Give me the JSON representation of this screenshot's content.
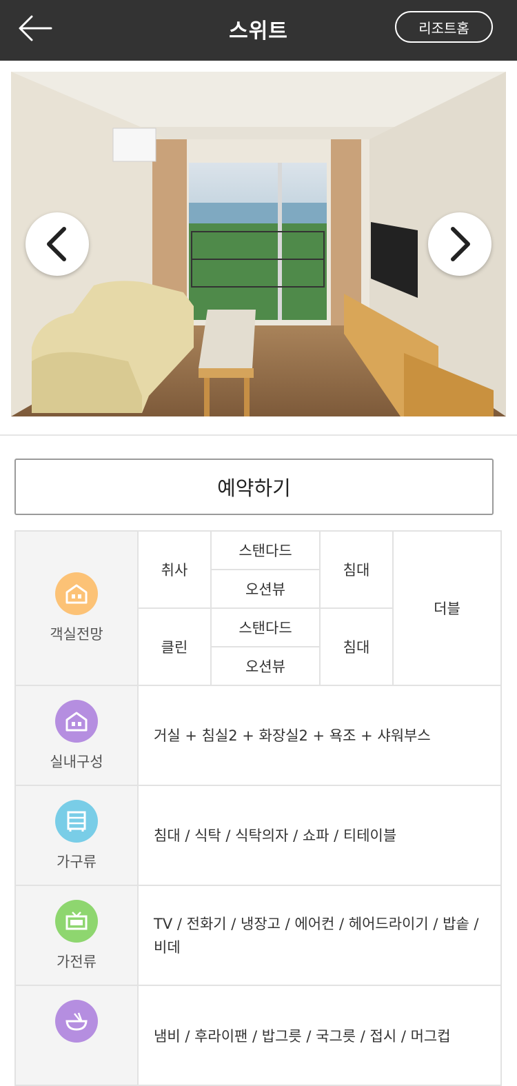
{
  "header": {
    "title": "스위트",
    "home_label": "리조트홈"
  },
  "reserve_label": "예약하기",
  "colors": {
    "header_bg": "#333333",
    "view_icon": "#fcc276",
    "layout_icon": "#b58ee0",
    "furniture_icon": "#79cde7",
    "appliance_icon": "#8ed66f",
    "kitchen_icon": "#b58ee0"
  },
  "room_view": {
    "label": "객실전망",
    "types": [
      {
        "name": "취사",
        "views": [
          "스탠다드",
          "오션뷰"
        ],
        "bed": "침대"
      },
      {
        "name": "클린",
        "views": [
          "스탠다드",
          "오션뷰"
        ],
        "bed": "침대"
      }
    ],
    "bed_type": "더블"
  },
  "layout": {
    "label": "실내구성",
    "value": "거실 + 침실2 + 화장실2 + 욕조 + 샤워부스"
  },
  "furniture": {
    "label": "가구류",
    "value": "침대 / 식탁 / 식탁의자 / 쇼파 / 티테이블"
  },
  "appliances": {
    "label": "가전류",
    "value": "TV / 전화기 / 냉장고 / 에어컨 / 헤어드라이기 / 밥솥 / 비데"
  },
  "kitchen": {
    "value": "냄비 / 후라이팬 / 밥그릇 / 국그릇 / 접시 / 머그컵"
  }
}
